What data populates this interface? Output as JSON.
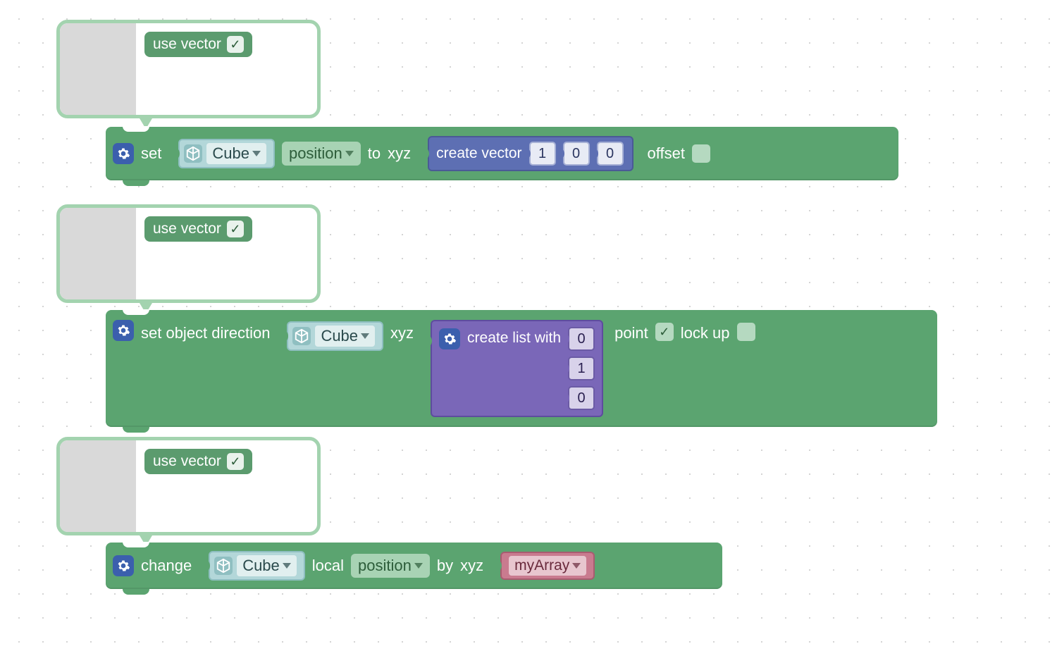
{
  "mutator": {
    "option_label": "use vector",
    "checked_glyph": "✓"
  },
  "block1": {
    "set": "set",
    "object": "Cube",
    "property": "position",
    "to": "to",
    "xyz": "xyz",
    "offset": "offset",
    "offset_checked": false,
    "vector": {
      "label": "create vector",
      "x": "1",
      "y": "0",
      "z": "0"
    }
  },
  "block2": {
    "label": "set object direction",
    "object": "Cube",
    "xyz": "xyz",
    "point": "point",
    "point_checked": true,
    "lockup": "lock up",
    "lockup_checked": false,
    "list": {
      "label": "create list with",
      "values": [
        "0",
        "1",
        "0"
      ]
    }
  },
  "block3": {
    "change": "change",
    "object": "Cube",
    "local": "local",
    "property": "position",
    "by": "by",
    "xyz": "xyz",
    "var": "myArray"
  }
}
